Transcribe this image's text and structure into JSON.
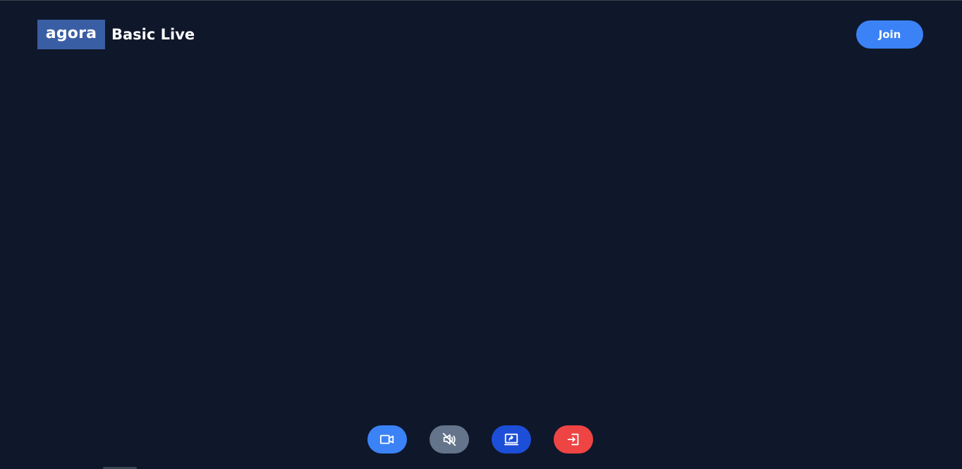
{
  "header": {
    "logo_text": "agora",
    "title": "Basic Live",
    "join_label": "Join"
  },
  "controls": [
    {
      "name": "camera",
      "icon": "video-camera-icon",
      "color": "#3b82f6"
    },
    {
      "name": "microphone",
      "icon": "speaker-muted-icon",
      "color": "#64748b"
    },
    {
      "name": "screen-share",
      "icon": "screen-share-icon",
      "color": "#1d4ed8"
    },
    {
      "name": "leave",
      "icon": "exit-icon",
      "color": "#ef4444"
    }
  ],
  "colors": {
    "background": "#0f172a",
    "accent": "#3b82f6",
    "logo_bg": "#3a5ea3"
  }
}
